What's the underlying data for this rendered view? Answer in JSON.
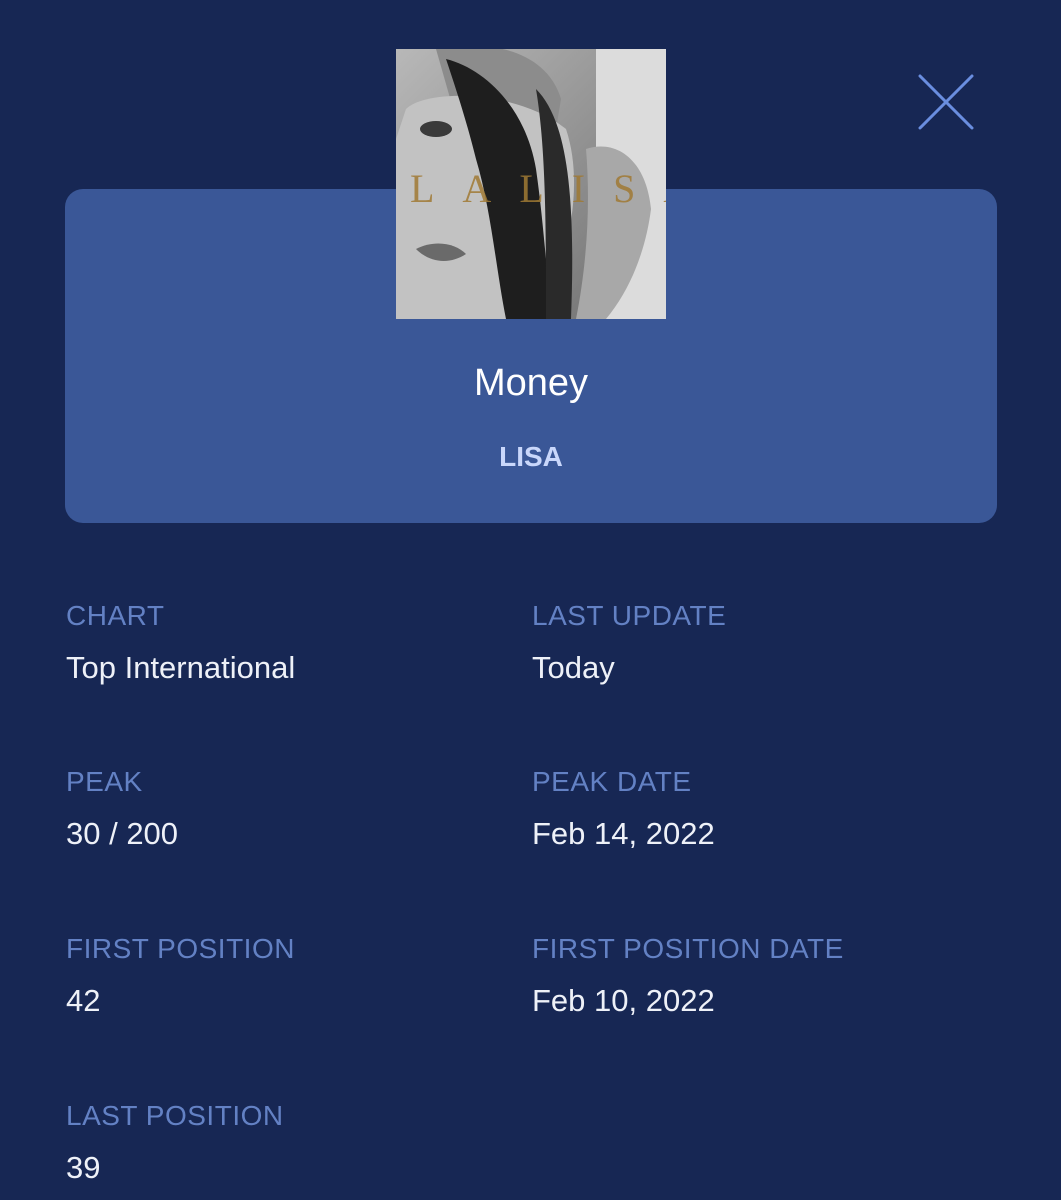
{
  "song": {
    "title": "Money",
    "artist": "LISA",
    "cover_text": "LALISA"
  },
  "close_icon": "close-icon",
  "details": {
    "chart": {
      "label": "CHART",
      "value": "Top International"
    },
    "last_update": {
      "label": "LAST UPDATE",
      "value": "Today"
    },
    "peak": {
      "label": "PEAK",
      "value": "30 / 200"
    },
    "peak_date": {
      "label": "PEAK DATE",
      "value": "Feb 14, 2022"
    },
    "first_position": {
      "label": "FIRST POSITION",
      "value": "42"
    },
    "first_position_date": {
      "label": "FIRST POSITION DATE",
      "value": "Feb 10, 2022"
    },
    "last_position": {
      "label": "LAST POSITION",
      "value": "39"
    }
  },
  "colors": {
    "background": "#172754",
    "card": "#3a5797",
    "label": "#6381c4",
    "value": "#eef1f8",
    "artist": "#c9d7fb",
    "close_icon": "#6a8ee0"
  }
}
